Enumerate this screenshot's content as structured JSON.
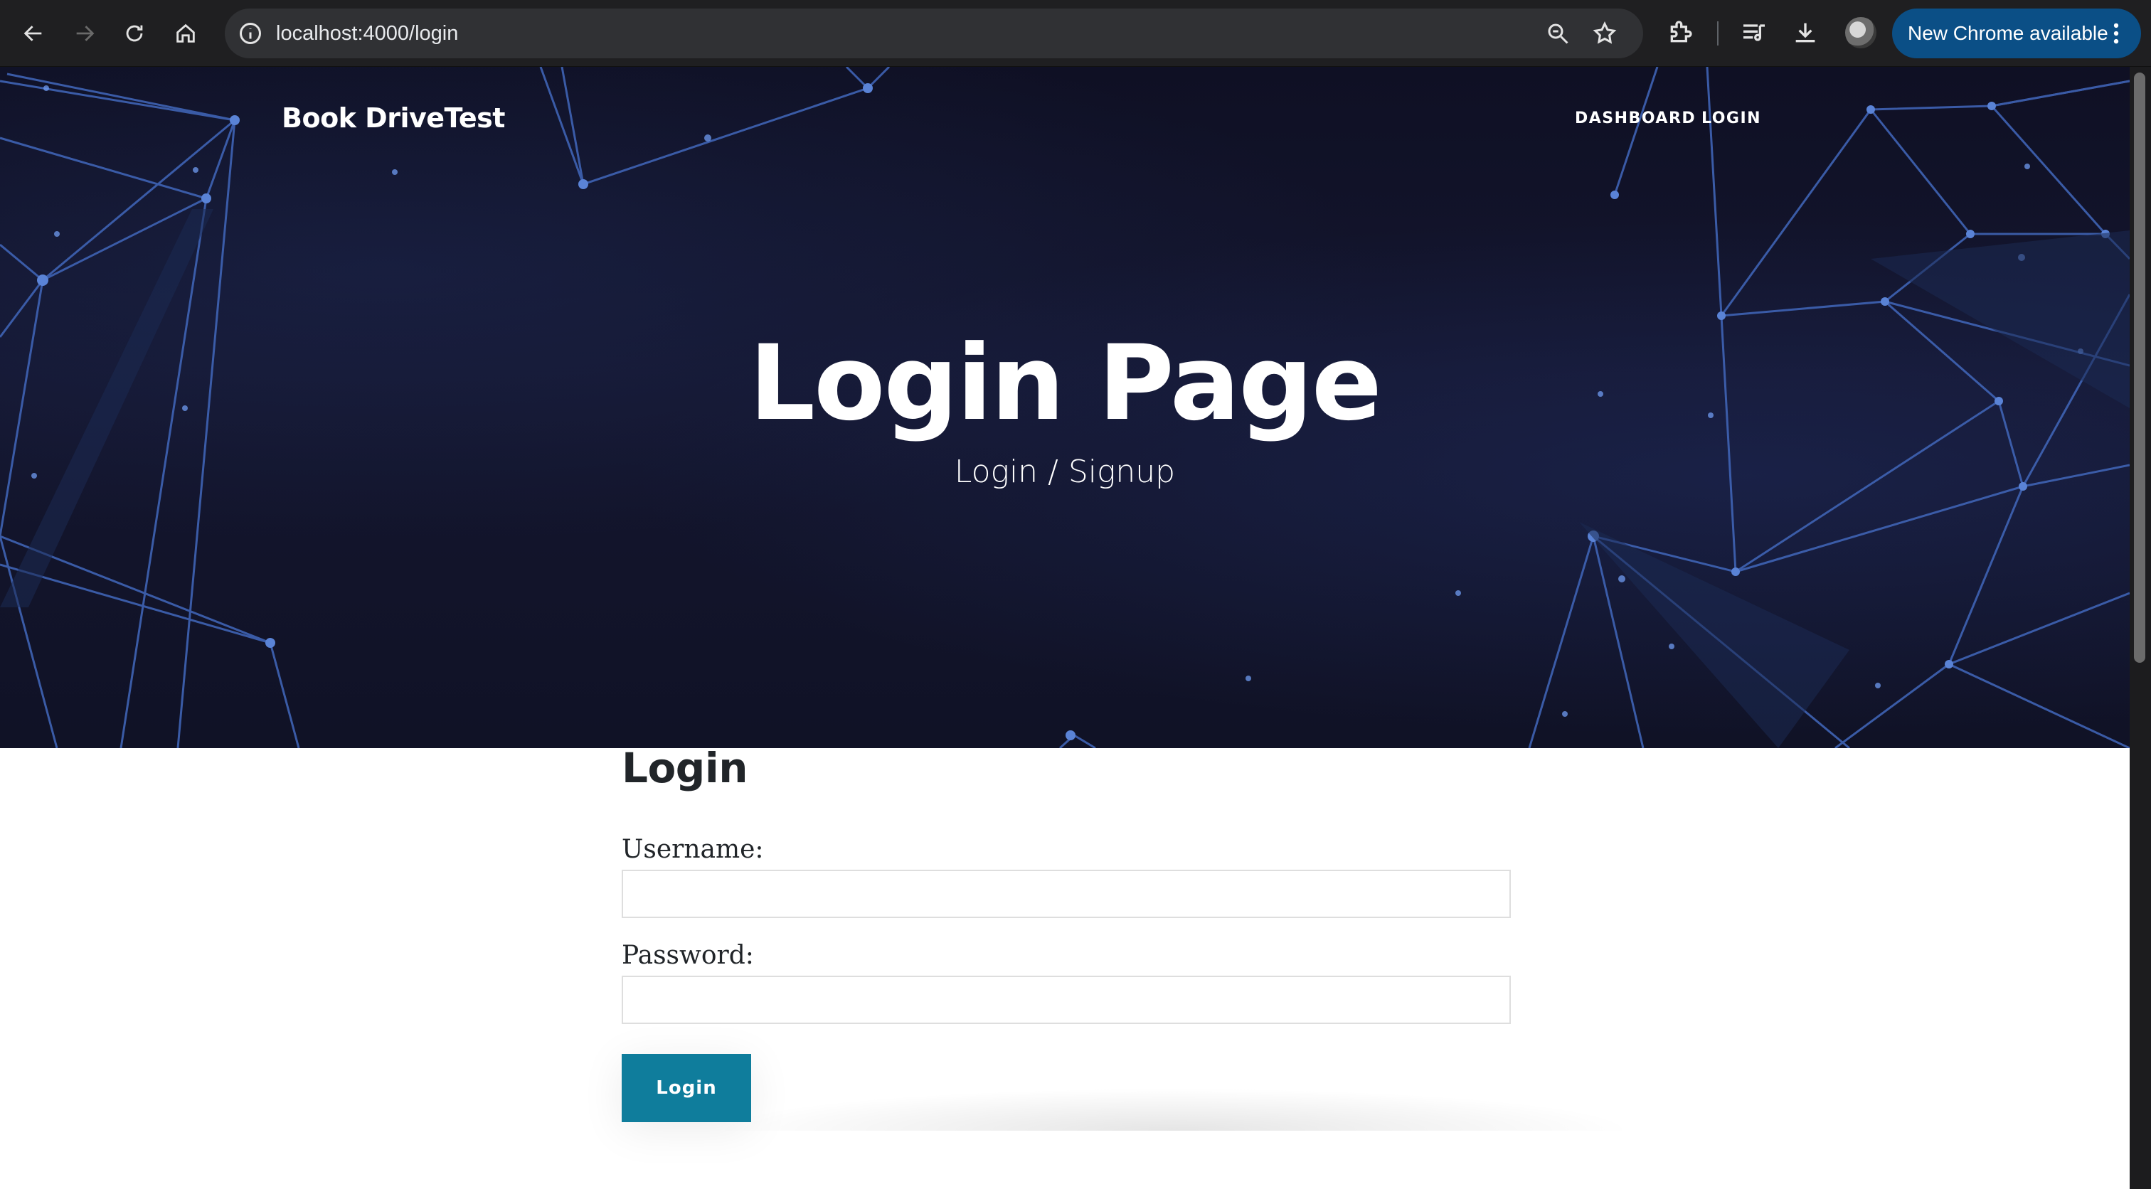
{
  "browser": {
    "url": "localhost:4000/login",
    "update_label": "New Chrome available",
    "icons": {
      "back": "arrow-left-icon",
      "forward": "arrow-right-icon",
      "reload": "reload-icon",
      "home": "home-icon",
      "site_info": "info-icon",
      "zoom": "zoom-icon",
      "bookmark": "star-icon",
      "extensions": "puzzle-icon",
      "media": "media-controls-icon",
      "downloads": "download-icon",
      "menu": "kebab-menu-icon"
    },
    "colors": {
      "toolbar": "#1f1f21",
      "omnibox": "#303134",
      "update_button": "#0b4f86"
    }
  },
  "site": {
    "brand": "Book DriveTest",
    "nav": [
      {
        "label": "DASHBOARD"
      },
      {
        "label": "LOGIN"
      }
    ]
  },
  "hero": {
    "title": "Login Page",
    "subtitle": "Login / Signup",
    "colors": {
      "background": "#13152d",
      "lines": "#3f63b4"
    }
  },
  "form": {
    "heading": "Login",
    "username_label": "Username:",
    "username_value": "",
    "password_label": "Password:",
    "password_value": "",
    "submit_label": "Login",
    "colors": {
      "submit_button": "#0f7d9c"
    }
  }
}
